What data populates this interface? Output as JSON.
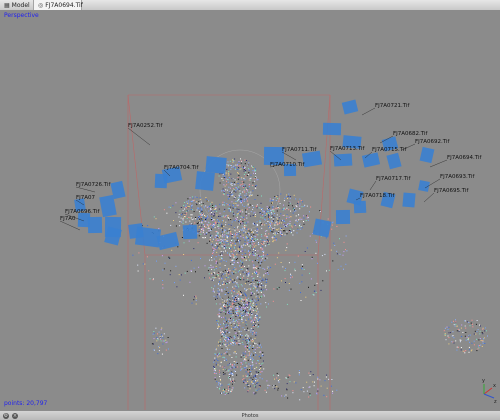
{
  "tabs": [
    {
      "label": "Model",
      "icon": "model-icon"
    },
    {
      "label": "FJ7A0694.Tif",
      "icon": "image-icon"
    }
  ],
  "viewport": {
    "mode_label": "Perspective",
    "points_label": "points: 20,797"
  },
  "camera_labels": [
    "FJ7A0721.Tif",
    "FJ7A0252.Tif",
    "FJ7A0682.Tif",
    "FJ7A0692.Tif",
    "FJ7A0711.Tif",
    "FJ7A0713.Tif",
    "FJ7A0715.Tif",
    "FJ7A0694.Tif",
    "FJ7A0704.Tif",
    "FJ7A0710.Tif",
    "FJ7A0693.Tif",
    "FJ7A0717.Tif",
    "FJ7A0695.Tif",
    "FJ7A0718.Tif",
    "FJ7A0696.Tif",
    "FJ7A0726.Tif",
    "FJ7A07",
    "FJ7A0"
  ],
  "bottom_bar": {
    "title": "Photos",
    "left_icon": "gear-icon",
    "right_icon": "close-icon"
  },
  "colors": {
    "camera_plane": "#3a7fd0",
    "bounding_box": "#c86060",
    "axis_x": "#cc3333",
    "axis_y": "#33aa33",
    "axis_z": "#3355cc"
  }
}
